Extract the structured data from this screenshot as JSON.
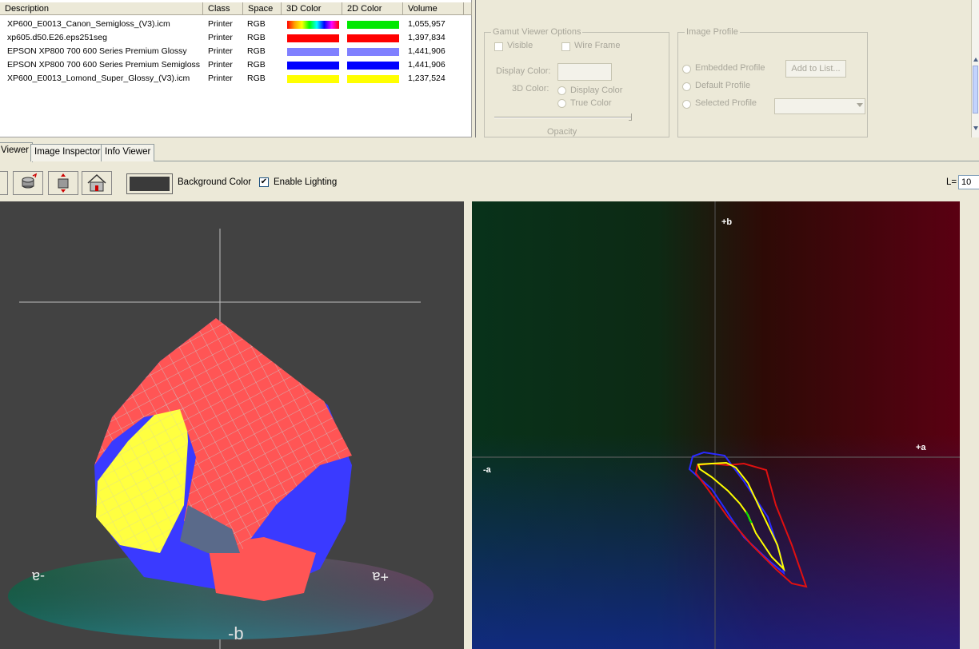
{
  "table": {
    "columns": [
      "Description",
      "Class",
      "Space",
      "3D Color",
      "2D Color",
      "Volume"
    ],
    "rows": [
      {
        "description": "XP600_E0013_Canon_Semigloss_(V3).icm",
        "class": "Printer",
        "space": "RGB",
        "color3d": "rainbow",
        "color2d": "#00e800",
        "volume": "1,055,957"
      },
      {
        "description": "xp605.d50.E26.eps251seg",
        "class": "Printer",
        "space": "RGB",
        "color3d": "#ff0000",
        "color2d": "#ff0000",
        "volume": "1,397,834"
      },
      {
        "description": "EPSON XP800 700 600 Series Premium Glossy",
        "class": "Printer",
        "space": "RGB",
        "color3d": "#8080ff",
        "color2d": "#8080ff",
        "volume": "1,441,906"
      },
      {
        "description": "EPSON XP800 700 600 Series Premium Semigloss",
        "class": "Printer",
        "space": "RGB",
        "color3d": "#0000ff",
        "color2d": "#0000ff",
        "volume": "1,441,906"
      },
      {
        "description": "XP600_E0013_Lomond_Super_Glossy_(V3).icm",
        "class": "Printer",
        "space": "RGB",
        "color3d": "#ffff00",
        "color2d": "#ffff00",
        "volume": "1,237,524"
      }
    ]
  },
  "options": {
    "gamut_group": "Gamut Viewer Options",
    "visible": "Visible",
    "wire_frame": "Wire Frame",
    "display_color": "Display Color:",
    "color_3d": "3D Color:",
    "display_color_radio": "Display Color",
    "true_color": "True Color",
    "opacity": "Opacity",
    "profile_group": "Image Profile",
    "embedded_profile": "Embedded Profile",
    "default_profile": "Default Profile",
    "selected_profile": "Selected Profile",
    "add_to_list": "Add to List..."
  },
  "tabs": [
    "Viewer",
    "Image Inspector",
    "Info Viewer"
  ],
  "toolbar": {
    "background_color": "Background Color",
    "enable_lighting": "Enable Lighting",
    "l_label": "L=",
    "l_value": "10"
  },
  "view3d": {
    "axis_minus_a": "-a",
    "axis_plus_a": "+a",
    "axis_minus_b": "-b"
  },
  "view2d": {
    "plus_b": "+b",
    "minus_a": "-a",
    "plus_a": "+a"
  },
  "colors": {
    "red": "#ff5555",
    "yellow": "#ffff40",
    "blue": "#3a3aff",
    "green": "#00e000"
  }
}
